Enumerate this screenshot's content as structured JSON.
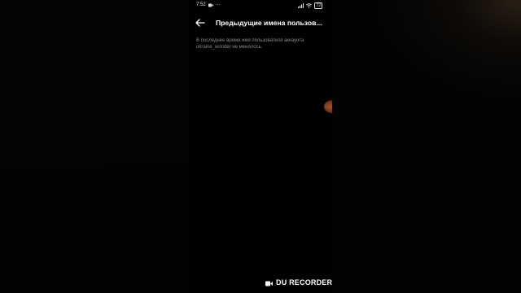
{
  "status_bar": {
    "time": "7:52",
    "extra": "···",
    "battery": "72"
  },
  "app_bar": {
    "back_icon": "back-arrow-icon",
    "title": "Предыдущие имена пользов..."
  },
  "content": {
    "message": "В последнее время имя пользователя аккаунта ukraine_wonder не менялось."
  },
  "watermark": {
    "text": "DU RECORDER",
    "icon": "video-camera-icon"
  }
}
